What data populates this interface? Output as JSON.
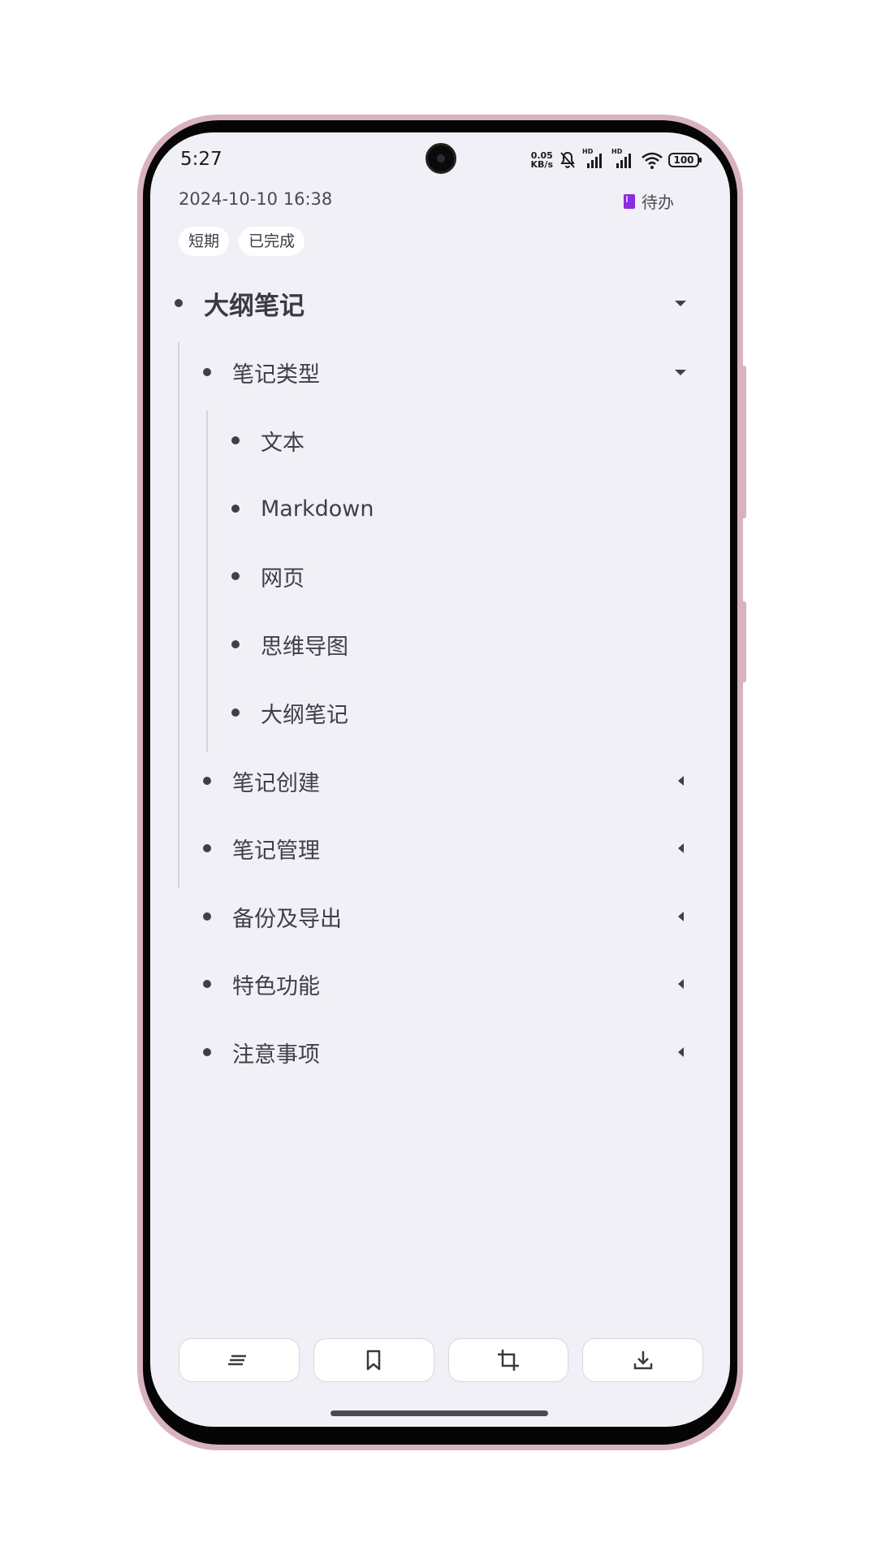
{
  "status_bar": {
    "time": "5:27",
    "net_speed_value": "0.05",
    "net_speed_unit": "KB/s",
    "signal_1_label": "HD",
    "signal_2_label": "HD",
    "battery": "100"
  },
  "note_meta": {
    "date": "2024-10-10 16:38",
    "category": "待办",
    "category_color": "#8a2be2",
    "tags": [
      "短期",
      "已完成"
    ]
  },
  "outline": {
    "root": {
      "label": "大纲笔记",
      "expanded": true
    },
    "items": [
      {
        "label": "笔记类型",
        "expanded": true
      },
      {
        "label": "文本"
      },
      {
        "label": "Markdown"
      },
      {
        "label": "网页"
      },
      {
        "label": "思维导图"
      },
      {
        "label": "大纲笔记"
      },
      {
        "label": "笔记创建",
        "expanded": false
      },
      {
        "label": "笔记管理",
        "expanded": false
      },
      {
        "label": "备份及导出",
        "expanded": false
      },
      {
        "label": "特色功能",
        "expanded": false
      },
      {
        "label": "注意事项",
        "expanded": false
      }
    ]
  },
  "toolbar": {
    "buttons": [
      {
        "icon": "outline-list-icon"
      },
      {
        "icon": "bookmark-icon"
      },
      {
        "icon": "crop-icon"
      },
      {
        "icon": "download-icon"
      }
    ]
  }
}
